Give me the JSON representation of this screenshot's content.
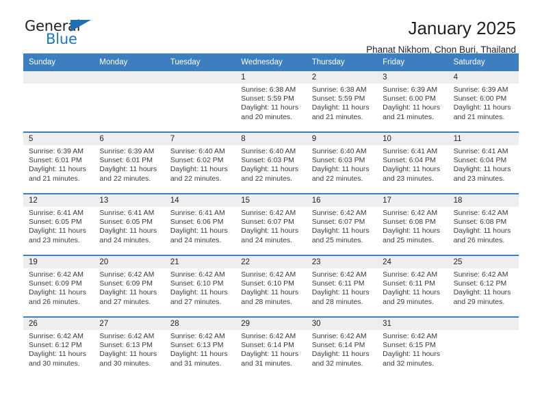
{
  "brand": {
    "name_dark": "General",
    "name_blue": "Blue",
    "triangle_icon": "brand-triangle-icon",
    "accent_color": "#1f6eb4"
  },
  "header": {
    "title": "January 2025",
    "subtitle": "Phanat Nikhom, Chon Buri, Thailand"
  },
  "calendar": {
    "header_bg": "#3c7fc0",
    "header_text_color": "#ffffff",
    "daynum_bg": "#eeeeee",
    "weekdays": [
      "Sunday",
      "Monday",
      "Tuesday",
      "Wednesday",
      "Thursday",
      "Friday",
      "Saturday"
    ],
    "weeks": [
      [
        {
          "day": "",
          "sunrise": "",
          "sunset": "",
          "daylight_1": "",
          "daylight_2": ""
        },
        {
          "day": "",
          "sunrise": "",
          "sunset": "",
          "daylight_1": "",
          "daylight_2": ""
        },
        {
          "day": "",
          "sunrise": "",
          "sunset": "",
          "daylight_1": "",
          "daylight_2": ""
        },
        {
          "day": "1",
          "sunrise": "Sunrise: 6:38 AM",
          "sunset": "Sunset: 5:59 PM",
          "daylight_1": "Daylight: 11 hours",
          "daylight_2": "and 20 minutes."
        },
        {
          "day": "2",
          "sunrise": "Sunrise: 6:38 AM",
          "sunset": "Sunset: 5:59 PM",
          "daylight_1": "Daylight: 11 hours",
          "daylight_2": "and 21 minutes."
        },
        {
          "day": "3",
          "sunrise": "Sunrise: 6:39 AM",
          "sunset": "Sunset: 6:00 PM",
          "daylight_1": "Daylight: 11 hours",
          "daylight_2": "and 21 minutes."
        },
        {
          "day": "4",
          "sunrise": "Sunrise: 6:39 AM",
          "sunset": "Sunset: 6:00 PM",
          "daylight_1": "Daylight: 11 hours",
          "daylight_2": "and 21 minutes."
        }
      ],
      [
        {
          "day": "5",
          "sunrise": "Sunrise: 6:39 AM",
          "sunset": "Sunset: 6:01 PM",
          "daylight_1": "Daylight: 11 hours",
          "daylight_2": "and 21 minutes."
        },
        {
          "day": "6",
          "sunrise": "Sunrise: 6:39 AM",
          "sunset": "Sunset: 6:01 PM",
          "daylight_1": "Daylight: 11 hours",
          "daylight_2": "and 22 minutes."
        },
        {
          "day": "7",
          "sunrise": "Sunrise: 6:40 AM",
          "sunset": "Sunset: 6:02 PM",
          "daylight_1": "Daylight: 11 hours",
          "daylight_2": "and 22 minutes."
        },
        {
          "day": "8",
          "sunrise": "Sunrise: 6:40 AM",
          "sunset": "Sunset: 6:03 PM",
          "daylight_1": "Daylight: 11 hours",
          "daylight_2": "and 22 minutes."
        },
        {
          "day": "9",
          "sunrise": "Sunrise: 6:40 AM",
          "sunset": "Sunset: 6:03 PM",
          "daylight_1": "Daylight: 11 hours",
          "daylight_2": "and 22 minutes."
        },
        {
          "day": "10",
          "sunrise": "Sunrise: 6:41 AM",
          "sunset": "Sunset: 6:04 PM",
          "daylight_1": "Daylight: 11 hours",
          "daylight_2": "and 23 minutes."
        },
        {
          "day": "11",
          "sunrise": "Sunrise: 6:41 AM",
          "sunset": "Sunset: 6:04 PM",
          "daylight_1": "Daylight: 11 hours",
          "daylight_2": "and 23 minutes."
        }
      ],
      [
        {
          "day": "12",
          "sunrise": "Sunrise: 6:41 AM",
          "sunset": "Sunset: 6:05 PM",
          "daylight_1": "Daylight: 11 hours",
          "daylight_2": "and 23 minutes."
        },
        {
          "day": "13",
          "sunrise": "Sunrise: 6:41 AM",
          "sunset": "Sunset: 6:05 PM",
          "daylight_1": "Daylight: 11 hours",
          "daylight_2": "and 24 minutes."
        },
        {
          "day": "14",
          "sunrise": "Sunrise: 6:41 AM",
          "sunset": "Sunset: 6:06 PM",
          "daylight_1": "Daylight: 11 hours",
          "daylight_2": "and 24 minutes."
        },
        {
          "day": "15",
          "sunrise": "Sunrise: 6:42 AM",
          "sunset": "Sunset: 6:07 PM",
          "daylight_1": "Daylight: 11 hours",
          "daylight_2": "and 24 minutes."
        },
        {
          "day": "16",
          "sunrise": "Sunrise: 6:42 AM",
          "sunset": "Sunset: 6:07 PM",
          "daylight_1": "Daylight: 11 hours",
          "daylight_2": "and 25 minutes."
        },
        {
          "day": "17",
          "sunrise": "Sunrise: 6:42 AM",
          "sunset": "Sunset: 6:08 PM",
          "daylight_1": "Daylight: 11 hours",
          "daylight_2": "and 25 minutes."
        },
        {
          "day": "18",
          "sunrise": "Sunrise: 6:42 AM",
          "sunset": "Sunset: 6:08 PM",
          "daylight_1": "Daylight: 11 hours",
          "daylight_2": "and 26 minutes."
        }
      ],
      [
        {
          "day": "19",
          "sunrise": "Sunrise: 6:42 AM",
          "sunset": "Sunset: 6:09 PM",
          "daylight_1": "Daylight: 11 hours",
          "daylight_2": "and 26 minutes."
        },
        {
          "day": "20",
          "sunrise": "Sunrise: 6:42 AM",
          "sunset": "Sunset: 6:09 PM",
          "daylight_1": "Daylight: 11 hours",
          "daylight_2": "and 27 minutes."
        },
        {
          "day": "21",
          "sunrise": "Sunrise: 6:42 AM",
          "sunset": "Sunset: 6:10 PM",
          "daylight_1": "Daylight: 11 hours",
          "daylight_2": "and 27 minutes."
        },
        {
          "day": "22",
          "sunrise": "Sunrise: 6:42 AM",
          "sunset": "Sunset: 6:10 PM",
          "daylight_1": "Daylight: 11 hours",
          "daylight_2": "and 28 minutes."
        },
        {
          "day": "23",
          "sunrise": "Sunrise: 6:42 AM",
          "sunset": "Sunset: 6:11 PM",
          "daylight_1": "Daylight: 11 hours",
          "daylight_2": "and 28 minutes."
        },
        {
          "day": "24",
          "sunrise": "Sunrise: 6:42 AM",
          "sunset": "Sunset: 6:11 PM",
          "daylight_1": "Daylight: 11 hours",
          "daylight_2": "and 29 minutes."
        },
        {
          "day": "25",
          "sunrise": "Sunrise: 6:42 AM",
          "sunset": "Sunset: 6:12 PM",
          "daylight_1": "Daylight: 11 hours",
          "daylight_2": "and 29 minutes."
        }
      ],
      [
        {
          "day": "26",
          "sunrise": "Sunrise: 6:42 AM",
          "sunset": "Sunset: 6:12 PM",
          "daylight_1": "Daylight: 11 hours",
          "daylight_2": "and 30 minutes."
        },
        {
          "day": "27",
          "sunrise": "Sunrise: 6:42 AM",
          "sunset": "Sunset: 6:13 PM",
          "daylight_1": "Daylight: 11 hours",
          "daylight_2": "and 30 minutes."
        },
        {
          "day": "28",
          "sunrise": "Sunrise: 6:42 AM",
          "sunset": "Sunset: 6:13 PM",
          "daylight_1": "Daylight: 11 hours",
          "daylight_2": "and 31 minutes."
        },
        {
          "day": "29",
          "sunrise": "Sunrise: 6:42 AM",
          "sunset": "Sunset: 6:14 PM",
          "daylight_1": "Daylight: 11 hours",
          "daylight_2": "and 31 minutes."
        },
        {
          "day": "30",
          "sunrise": "Sunrise: 6:42 AM",
          "sunset": "Sunset: 6:14 PM",
          "daylight_1": "Daylight: 11 hours",
          "daylight_2": "and 32 minutes."
        },
        {
          "day": "31",
          "sunrise": "Sunrise: 6:42 AM",
          "sunset": "Sunset: 6:15 PM",
          "daylight_1": "Daylight: 11 hours",
          "daylight_2": "and 32 minutes."
        },
        {
          "day": "",
          "sunrise": "",
          "sunset": "",
          "daylight_1": "",
          "daylight_2": ""
        }
      ]
    ]
  }
}
